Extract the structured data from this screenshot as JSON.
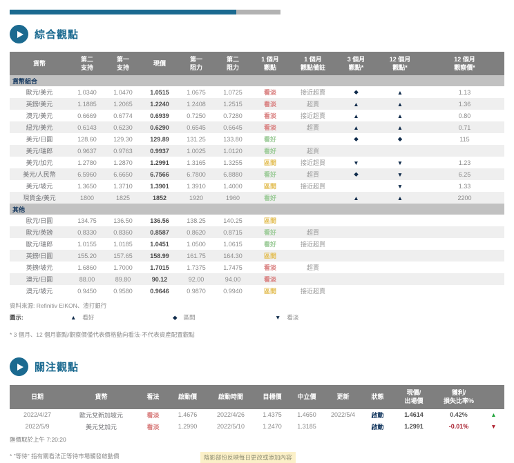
{
  "colors": {
    "accent-blue": "#1B6A90",
    "header-gray": "#7F7F7F",
    "group-gray": "#C1C1C1",
    "navy": "#12365E",
    "arrow-navy": "#0F2B4B",
    "bearish": "#D97F7F",
    "bullish": "#9CCB98",
    "range": "#E3BE55",
    "profit-green": "#22A53C",
    "loss-red": "#A8202F",
    "highlight": "#FBF0C8"
  },
  "section1": {
    "title": "綜合觀點",
    "table": {
      "headers": [
        "貨幣",
        "第二\n支持",
        "第一\n支持",
        "現價",
        "第一\n阻力",
        "第二\n阻力",
        "1 個月\n觀點",
        "1 個月\n觀點備註",
        "3 個月\n觀點*",
        "12 個月\n觀點*",
        "12 個月\n觀察價*"
      ],
      "groups": [
        {
          "name": "貨幣組合",
          "rows": [
            {
              "pair": "歐元/美元",
              "s2": "1.0340",
              "s1": "1.0470",
              "spot": "1.0515",
              "r1": "1.0675",
              "r2": "1.0725",
              "view": "看淡",
              "view_class": "bearish",
              "note": "接近超賣",
              "m3": "◆",
              "m12": "▲",
              "watch": "1.13"
            },
            {
              "pair": "英鎊/美元",
              "s2": "1.1885",
              "s1": "1.2065",
              "spot": "1.2240",
              "r1": "1.2408",
              "r2": "1.2515",
              "view": "看淡",
              "view_class": "bearish",
              "note": "超賣",
              "m3": "▲",
              "m12": "▲",
              "watch": "1.36"
            },
            {
              "pair": "澳元/美元",
              "s2": "0.6669",
              "s1": "0.6774",
              "spot": "0.6939",
              "r1": "0.7250",
              "r2": "0.7280",
              "view": "看淡",
              "view_class": "bearish",
              "note": "接近超賣",
              "m3": "▲",
              "m12": "▲",
              "watch": "0.80"
            },
            {
              "pair": "紐元/美元",
              "s2": "0.6143",
              "s1": "0.6230",
              "spot": "0.6290",
              "r1": "0.6545",
              "r2": "0.6645",
              "view": "看淡",
              "view_class": "bearish",
              "note": "超賣",
              "m3": "▲",
              "m12": "▲",
              "watch": "0.71"
            },
            {
              "pair": "美元/日圓",
              "s2": "128.60",
              "s1": "129.30",
              "spot": "129.89",
              "r1": "131.25",
              "r2": "133.80",
              "view": "看好",
              "view_class": "bullish",
              "note": "",
              "m3": "◆",
              "m12": "◆",
              "watch": "115"
            },
            {
              "pair": "美元/瑞郎",
              "s2": "0.9637",
              "s1": "0.9763",
              "spot": "0.9937",
              "r1": "1.0025",
              "r2": "1.0120",
              "view": "看好",
              "view_class": "bullish",
              "note": "超買",
              "m3": "",
              "m12": "",
              "watch": ""
            },
            {
              "pair": "美元/加元",
              "s2": "1.2780",
              "s1": "1.2870",
              "spot": "1.2991",
              "r1": "1.3165",
              "r2": "1.3255",
              "view": "區間",
              "view_class": "range",
              "note": "接近超買",
              "m3": "▼",
              "m12": "▼",
              "watch": "1.23"
            },
            {
              "pair": "美元/人民幣",
              "s2": "6.5960",
              "s1": "6.6650",
              "spot": "6.7566",
              "r1": "6.7800",
              "r2": "6.8880",
              "view": "看好",
              "view_class": "bullish",
              "note": "超買",
              "m3": "◆",
              "m12": "▼",
              "watch": "6.25"
            },
            {
              "pair": "美元/坡元",
              "s2": "1.3650",
              "s1": "1.3710",
              "spot": "1.3901",
              "r1": "1.3910",
              "r2": "1.4000",
              "view": "區間",
              "view_class": "range",
              "note": "接近超買",
              "m3": "",
              "m12": "▼",
              "watch": "1.33"
            },
            {
              "pair": "現貨金/美元",
              "s2": "1800",
              "s1": "1825",
              "spot": "1852",
              "r1": "1920",
              "r2": "1960",
              "view": "看好",
              "view_class": "bullish",
              "note": "",
              "m3": "▲",
              "m12": "▲",
              "watch": "2200"
            }
          ]
        },
        {
          "name": "其他",
          "rows": [
            {
              "pair": "歐元/日圓",
              "s2": "134.75",
              "s1": "136.50",
              "spot": "136.56",
              "r1": "138.25",
              "r2": "140.25",
              "view": "區間",
              "view_class": "range",
              "note": "",
              "m3": "",
              "m12": "",
              "watch": ""
            },
            {
              "pair": "歐元/英鎊",
              "s2": "0.8330",
              "s1": "0.8360",
              "spot": "0.8587",
              "r1": "0.8620",
              "r2": "0.8715",
              "view": "看好",
              "view_class": "bullish",
              "note": "超買",
              "m3": "",
              "m12": "",
              "watch": ""
            },
            {
              "pair": "歐元/瑞郎",
              "s2": "1.0155",
              "s1": "1.0185",
              "spot": "1.0451",
              "r1": "1.0500",
              "r2": "1.0615",
              "view": "看好",
              "view_class": "bullish",
              "note": "接近超買",
              "m3": "",
              "m12": "",
              "watch": ""
            },
            {
              "pair": "英鎊/日圓",
              "s2": "155.20",
              "s1": "157.65",
              "spot": "158.99",
              "r1": "161.75",
              "r2": "164.30",
              "view": "區間",
              "view_class": "range",
              "note": "",
              "m3": "",
              "m12": "",
              "watch": ""
            },
            {
              "pair": "英鎊/坡元",
              "s2": "1.6860",
              "s1": "1.7000",
              "spot": "1.7015",
              "r1": "1.7375",
              "r2": "1.7475",
              "view": "看淡",
              "view_class": "bearish",
              "note": "超賣",
              "m3": "",
              "m12": "",
              "watch": ""
            },
            {
              "pair": "澳元/日圓",
              "s2": "88.00",
              "s1": "89.80",
              "spot": "90.12",
              "r1": "92.00",
              "r2": "94.00",
              "view": "看淡",
              "view_class": "bearish",
              "note": "",
              "m3": "",
              "m12": "",
              "watch": ""
            },
            {
              "pair": "澳元/坡元",
              "s2": "0.9450",
              "s1": "0.9580",
              "spot": "0.9646",
              "r1": "0.9870",
              "r2": "0.9940",
              "view": "區間",
              "view_class": "range",
              "note": "接近超賣",
              "m3": "",
              "m12": "",
              "watch": ""
            }
          ]
        }
      ]
    },
    "source": "資料來源: Refinitiv EIKON、渣打銀行",
    "legend": {
      "label": "圖示:",
      "items": [
        {
          "symbol": "▲",
          "label": "看好",
          "icon": "bullish-triangle-up-icon"
        },
        {
          "symbol": "◆",
          "label": "區間",
          "icon": "range-diamond-icon"
        },
        {
          "symbol": "▼",
          "label": "看淡",
          "icon": "bearish-triangle-down-icon"
        }
      ]
    },
    "footnote": "* 3 個月、12 個月觀點/觀察價僅代表價格動向看法·不代表資產配置觀點"
  },
  "section2": {
    "title": "關注觀點",
    "table": {
      "headers": [
        "日期",
        "貨幣",
        "看法",
        "啟動價",
        "啟動時間",
        "目標價",
        "中立價",
        "更新",
        "狀態",
        "現價/\n出場價",
        "獲利/\n損失比率%",
        ""
      ],
      "rows": [
        {
          "date": "2022/4/27",
          "currency": "歐元兌新加坡元",
          "view": "看淡",
          "view_class": "bearish",
          "entry_price": "1.4676",
          "entry_time": "2022/4/26",
          "target": "1.4375",
          "neutral": "1.4650",
          "updated": "2022/5/4",
          "status": "啟動",
          "current_price": "1.4614",
          "pl": "0.42%",
          "pl_arrow": "▲",
          "pl_class": "profit"
        },
        {
          "date": "2022/5/9",
          "currency": "美元兌加元",
          "view": "看淡",
          "view_class": "bearish",
          "entry_price": "1.2990",
          "entry_time": "2022/5/10",
          "target": "1.2470",
          "neutral": "1.3185",
          "updated": "",
          "status": "啟動",
          "current_price": "1.2991",
          "pl": "-0.01%",
          "pl_arrow": "▼",
          "pl_class": "loss"
        }
      ]
    },
    "rate_time": "匯價取於上午 7:20:20",
    "footnote_wait": "* \"等待\" 指有關看法正等待市場觸發啟動價",
    "footnote_shaded": "陰影部份反映每日更改或添加內容"
  }
}
